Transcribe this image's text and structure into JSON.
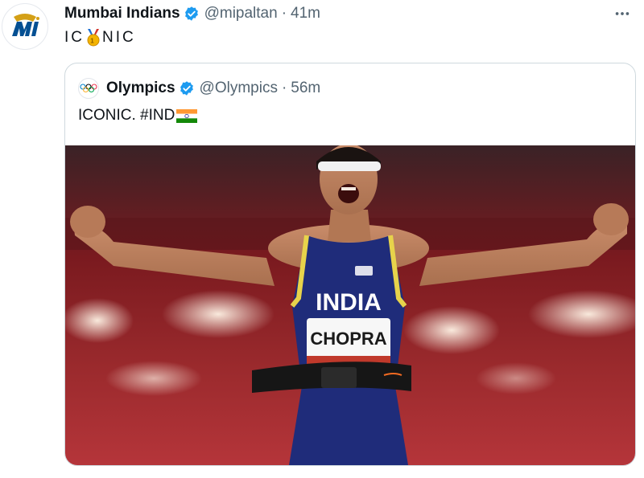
{
  "tweet": {
    "author_name": "Mumbai Indians",
    "author_handle": "@mipaltan",
    "separator": "·",
    "time": "41m",
    "text_before": "IC",
    "text_after": "NIC",
    "more_icon": "more-horizontal-icon",
    "avatar_icon": "mumbai-indians-logo"
  },
  "quoted": {
    "author_name": "Olympics",
    "author_handle": "@Olympics",
    "separator": "·",
    "time": "56m",
    "text": "ICONIC. #IND",
    "flag_icon": "india-flag-icon",
    "avatar_icon": "olympic-rings-logo",
    "photo": {
      "vest_text": "INDIA",
      "bib_text": "CHOPRA"
    }
  },
  "colors": {
    "verified": "#1d9bf0",
    "secondary_text": "#536471",
    "border": "#cfd9de",
    "mi_blue": "#045093",
    "vest_navy": "#1f2c7a",
    "stadium_red": "#7a1a1f"
  }
}
